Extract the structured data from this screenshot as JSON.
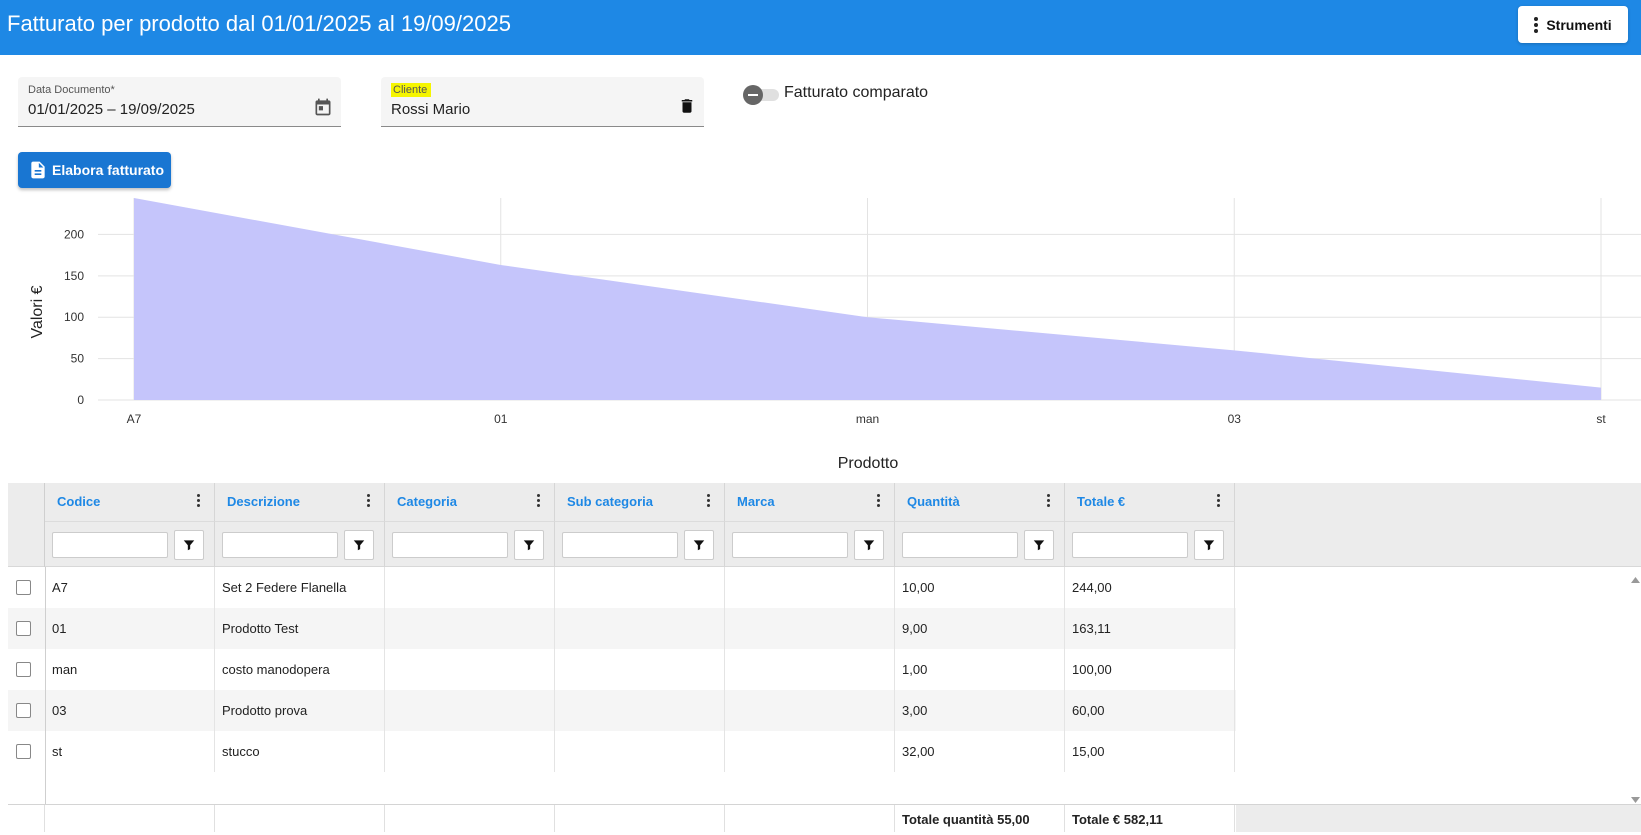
{
  "header": {
    "title": "Fatturato per prodotto dal 01/01/2025 al 19/09/2025",
    "tools_label": "Strumenti"
  },
  "filters": {
    "date": {
      "label": "Data Documento*",
      "value": "01/01/2025 – 19/09/2025"
    },
    "customer": {
      "label": "Cliente",
      "value": "Rossi Mario"
    },
    "compare_toggle": {
      "label": "Fatturato comparato",
      "on": false
    }
  },
  "actions": {
    "process_label": "Elabora fatturato"
  },
  "colors": {
    "appbar": "#1e88e5",
    "button": "#1976d2",
    "area_fill": "#c5c5fb",
    "header_text": "#1e88e5",
    "highlight": "#f5f500"
  },
  "chart_data": {
    "type": "area",
    "categories": [
      "A7",
      "01",
      "man",
      "03",
      "st"
    ],
    "series": [
      {
        "values": [
          244.0,
          163.11,
          100.0,
          60.0,
          15.0
        ]
      }
    ],
    "xlabel": "Prodotto",
    "ylabel": "Valori €",
    "yticks": [
      0,
      50,
      100,
      150,
      200
    ],
    "ylim": [
      0,
      244
    ],
    "grid": true
  },
  "table": {
    "columns": [
      "Codice",
      "Descrizione",
      "Categoria",
      "Sub categoria",
      "Marca",
      "Quantità",
      "Totale €"
    ],
    "rows": [
      [
        "A7",
        "Set 2 Federe Flanella",
        "",
        "",
        "",
        "10,00",
        "244,00"
      ],
      [
        "01",
        "Prodotto Test",
        "",
        "",
        "",
        "9,00",
        "163,11"
      ],
      [
        "man",
        "costo manodopera",
        "",
        "",
        "",
        "1,00",
        "100,00"
      ],
      [
        "03",
        "Prodotto prova",
        "",
        "",
        "",
        "3,00",
        "60,00"
      ],
      [
        "st",
        "stucco",
        "",
        "",
        "",
        "32,00",
        "15,00"
      ]
    ],
    "footer": {
      "total_quantity": "Totale quantità 55,00",
      "total_amount": "Totale € 582,11"
    }
  }
}
